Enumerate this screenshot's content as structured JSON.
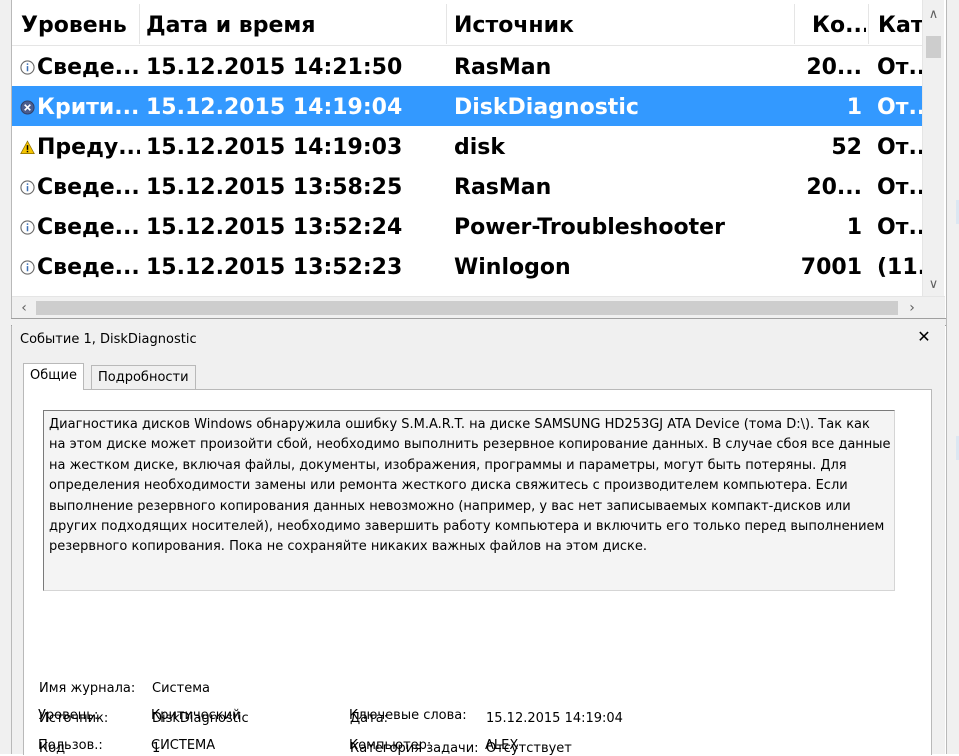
{
  "colors": {
    "selection": "#3399ff",
    "panel": "#f0f0f0"
  },
  "list": {
    "columns": [
      "Уровень",
      "Дата и время",
      "Источник",
      "Ко...",
      "Кат."
    ],
    "rows": [
      {
        "icon": "info-icon",
        "level": "Сведе...",
        "datetime": "15.12.2015 14:21:50",
        "source": "RasMan",
        "code": "20...",
        "category": "От...",
        "selected": false
      },
      {
        "icon": "error-icon",
        "level": "Крити...",
        "datetime": "15.12.2015 14:19:04",
        "source": "DiskDiagnostic",
        "code": "1",
        "category": "От...",
        "selected": true
      },
      {
        "icon": "warning-icon",
        "level": "Преду...",
        "datetime": "15.12.2015 14:19:03",
        "source": "disk",
        "code": "52",
        "category": "От...",
        "selected": false
      },
      {
        "icon": "info-icon",
        "level": "Сведе...",
        "datetime": "15.12.2015 13:58:25",
        "source": "RasMan",
        "code": "20...",
        "category": "От...",
        "selected": false
      },
      {
        "icon": "info-icon",
        "level": "Сведе...",
        "datetime": "15.12.2015 13:52:24",
        "source": "Power-Troubleshooter",
        "code": "1",
        "category": "От...",
        "selected": false
      },
      {
        "icon": "info-icon",
        "level": "Сведе...",
        "datetime": "15.12.2015 13:52:23",
        "source": "Winlogon",
        "code": "7001",
        "category": "(11.",
        "selected": false
      }
    ]
  },
  "detail": {
    "title": "Событие 1, DiskDiagnostic",
    "tabs": [
      "Общие",
      "Подробности"
    ],
    "description_lines": [
      "Диагностика дисков Windows обнаружила ошибку S.M.A.R.T. на диске SAMSUNG HD253GJ ATA Device (тома D:\\).  Так как",
      "на этом диске может произойти сбой, необходимо выполнить резервное копирование данных. В случае сбоя все данные",
      "на жестком диске, включая файлы, документы, изображения, программы и параметры, могут быть потеряны.  Для",
      "определения необходимости замены или ремонта жесткого диска свяжитесь с производителем компьютера.  Если",
      "выполнение резервного копирования данных невозможно (например, у вас нет записываемых компакт-дисков или",
      "других подходящих носителей), необходимо завершить работу компьютера и включить его только перед выполнением",
      "резервного копирования.  Пока не сохраняйте никаких важных файлов на этом диске."
    ],
    "props": {
      "log_name_label": "Имя журнала:",
      "log_name_value": "Система",
      "source_label": "Источник:",
      "source_value": "DiskDiagnostic",
      "date_label": "Дата:",
      "date_value": "15.12.2015 14:19:04",
      "code_label": "Код",
      "code_value": "1",
      "task_category_label": "Категория задачи:",
      "task_category_value": "Отсутствует",
      "level_label": "Уровень:",
      "level_value": "Критический",
      "keywords_label": "Ключевые слова:",
      "user_label": "Пользов.:",
      "user_value": "СИСТЕМА",
      "computer_label": "Компьютер:",
      "computer_value": "ALEX"
    }
  }
}
